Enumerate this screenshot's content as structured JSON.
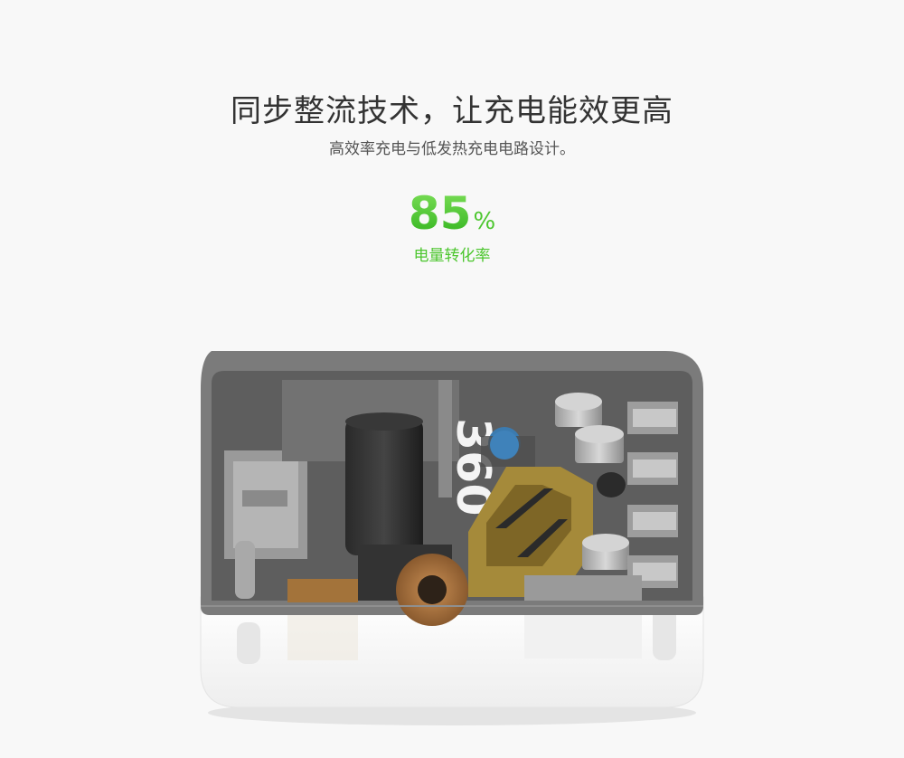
{
  "headline": "同步整流技术，让充电能效更高",
  "subtitle": "高效率充电与低发热充电电路设计。",
  "stat": {
    "value": "85",
    "unit": "%",
    "label": "电量转化率"
  },
  "product": {
    "brand_mark": "360"
  },
  "colors": {
    "accent_green": "#4cc62e",
    "background": "#f8f8f8",
    "text_dark": "#333333"
  }
}
